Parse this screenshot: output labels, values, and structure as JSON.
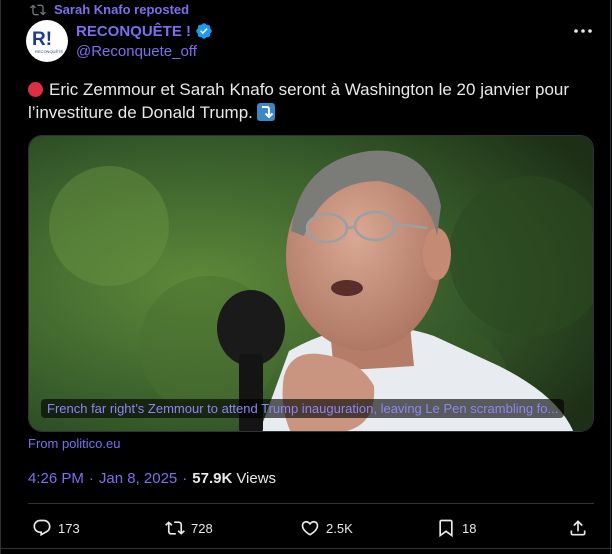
{
  "repost": {
    "label": "Sarah Knafo reposted"
  },
  "author": {
    "name": "RECONQUÊTE !",
    "handle": "@Reconquete_off",
    "avatar_letters": "R!",
    "avatar_small": "RECONQUÊTE"
  },
  "tweet": {
    "text": "Eric Zemmour et Sarah Knafo seront à Washington le 20 janvier pour l’investiture de Donald Trump."
  },
  "card": {
    "caption": "French far right’s Zemmour to attend Trump inauguration, leaving Le Pen scrambling fo...",
    "source": "From politico.eu"
  },
  "meta": {
    "time": "4:26 PM",
    "date": "Jan 8, 2025",
    "views_count": "57.9K",
    "views_label": "Views"
  },
  "actions": {
    "replies": "173",
    "reposts": "728",
    "likes": "2.5K",
    "bookmarks": "18"
  },
  "colors": {
    "accent": "#7b6ff0",
    "text": "#e7e9ea",
    "background": "#000000",
    "verified": "#1d9bf0",
    "red_dot": "#dd2e44"
  },
  "icons": [
    "repost-icon",
    "verified-badge-icon",
    "more-icon",
    "red-circle-emoji",
    "right-arrow-curving-down-emoji",
    "reply-icon",
    "retweet-icon",
    "like-icon",
    "bookmark-icon",
    "share-icon"
  ]
}
